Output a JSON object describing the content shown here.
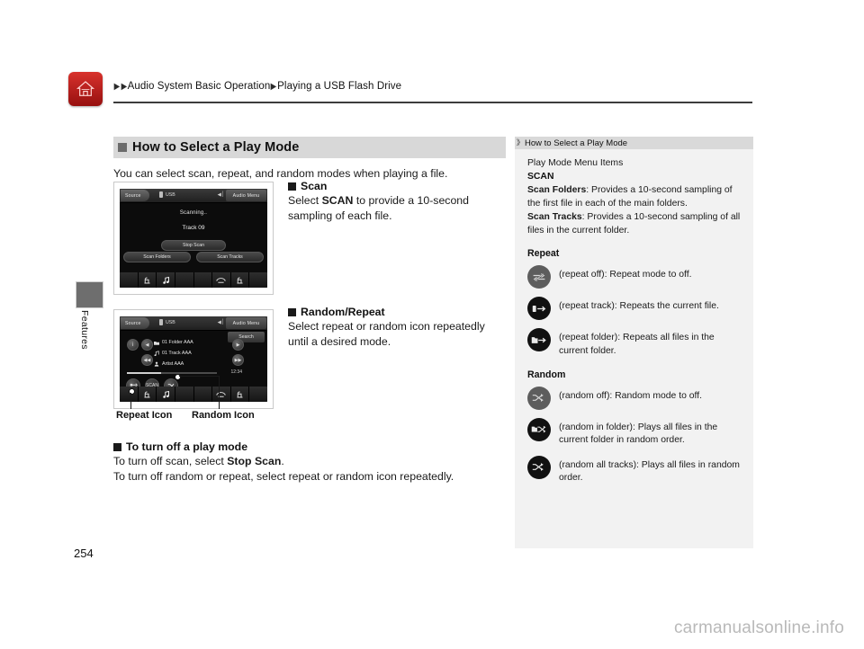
{
  "header": {
    "home_icon": "home-icon",
    "breadcrumb_arrow": "▶",
    "crumb_1": "Audio System Basic Operation",
    "crumb_2": "Playing a USB Flash Drive"
  },
  "left_rail": {
    "tab_label": "Features",
    "page_number": "254"
  },
  "main": {
    "section_title": "How to Select a Play Mode",
    "intro": "You can select scan, repeat, and random modes when playing a file.",
    "scan_block": {
      "heading": "Scan",
      "body_pre": "Select ",
      "body_bold": "SCAN",
      "body_post": " to provide a 10-second sampling of each file."
    },
    "random_block": {
      "heading": "Random/Repeat",
      "body": "Select repeat or random icon repeatedly until a desired mode."
    },
    "turnoff_block": {
      "heading": "To turn off a play mode",
      "line1_pre": "To turn off scan, select ",
      "line1_bold": "Stop Scan",
      "line1_post": ".",
      "line2": "To turn off random or repeat, select repeat or random icon repeatedly."
    },
    "callouts": {
      "repeat": "Repeat Icon",
      "random": "Random Icon"
    }
  },
  "screen_scan": {
    "source_button": "Source",
    "device_label": "USB",
    "volume_icon": "volume-icon",
    "audio_menu_button": "Audio Menu",
    "status": "Scanning..",
    "track": "Track 09",
    "stop_scan_button": "Stop Scan",
    "scan_folders_button": "Scan Folders",
    "scan_tracks_button": "Scan Tracks"
  },
  "screen_player": {
    "source_button": "Source",
    "device_label": "USB",
    "volume_icon": "volume-icon",
    "audio_menu_button": "Audio Menu",
    "search_button": "Search",
    "folder": "01 Folder AAA",
    "track": "01 Track AAA",
    "artist": "Artist AAA",
    "time": "12:34",
    "scan_button_label": "SCAN"
  },
  "sidebar": {
    "head_mark": "》",
    "head_title": "How to Select a Play Mode",
    "menu_items_label": "Play Mode Menu Items",
    "scan_label": "SCAN",
    "scan_folders_name": "Scan Folders",
    "scan_folders_desc": ": Provides a 10-second sampling of the first file in each of the main folders.",
    "scan_tracks_name": "Scan Tracks",
    "scan_tracks_desc": ": Provides a 10-second sampling of all files in the current folder.",
    "repeat_title": "Repeat",
    "repeat_items": [
      {
        "icon": "repeat-off-icon",
        "state": "off",
        "desc": "(repeat off): Repeat mode to off."
      },
      {
        "icon": "repeat-track-icon",
        "state": "on",
        "desc": "(repeat track): Repeats the current file."
      },
      {
        "icon": "repeat-folder-icon",
        "state": "on",
        "desc": "(repeat folder): Repeats all files in the current folder."
      }
    ],
    "random_title": "Random",
    "random_items": [
      {
        "icon": "random-off-icon",
        "state": "off",
        "desc": "(random off): Random mode to off."
      },
      {
        "icon": "random-in-folder-icon",
        "state": "on",
        "desc": "(random in folder): Plays all files in the current folder in random order."
      },
      {
        "icon": "random-all-tracks-icon",
        "state": "on",
        "desc": "(random all tracks): Plays all files in random order."
      }
    ]
  },
  "watermark": "carmanualsonline.info",
  "colors": {
    "brand_red": "#b41f1d",
    "banner_gray": "#d8d8d8",
    "sidebar_bg": "#f2f2f2",
    "sidebar_head": "#d9d9d9"
  }
}
